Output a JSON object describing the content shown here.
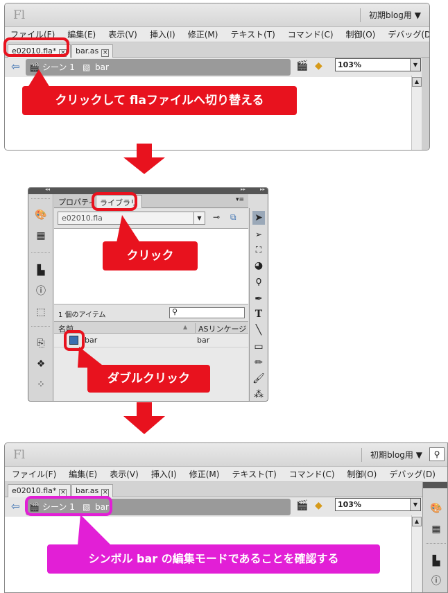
{
  "app": {
    "logo": "Fl",
    "workspace_top": "初期blog用 ▼",
    "workspace_bottom": "初期blog用 ▼",
    "menus": [
      "ファイル(F)",
      "編集(E)",
      "表示(V)",
      "挿入(I)",
      "修正(M)",
      "テキスト(T)",
      "コマンド(C)",
      "制御(O)",
      "デバッグ(D)"
    ],
    "tab_fla": "e02010.fla*",
    "tab_as": "bar.as",
    "tab_close": "×",
    "scene_label": "シーン 1",
    "symbol_label": "bar",
    "zoom": "103%"
  },
  "library": {
    "tab_properties": "プロパティ",
    "tab_library": "ライブラリ",
    "file_select": "e02010.fla",
    "item_count": "1 個のアイテム",
    "col_name": "名前",
    "col_linkage": "ASリンケージ",
    "sort_arrow": "▲",
    "row_name": "bar",
    "row_linkage": "bar",
    "collapse_left": "◂◂",
    "collapse_right": "▸▸",
    "panel_menu": "▾≡"
  },
  "callouts": {
    "step1": "クリックして flaファイルへ切り替える",
    "step2a": "クリック",
    "step2b": "ダブルクリック",
    "step3": "シンボル bar の編集モードであることを確認する"
  },
  "colors": {
    "callout_red": "#e8121e",
    "callout_magenta": "#e21fd6",
    "scene_bar": "#9a9a9a"
  }
}
